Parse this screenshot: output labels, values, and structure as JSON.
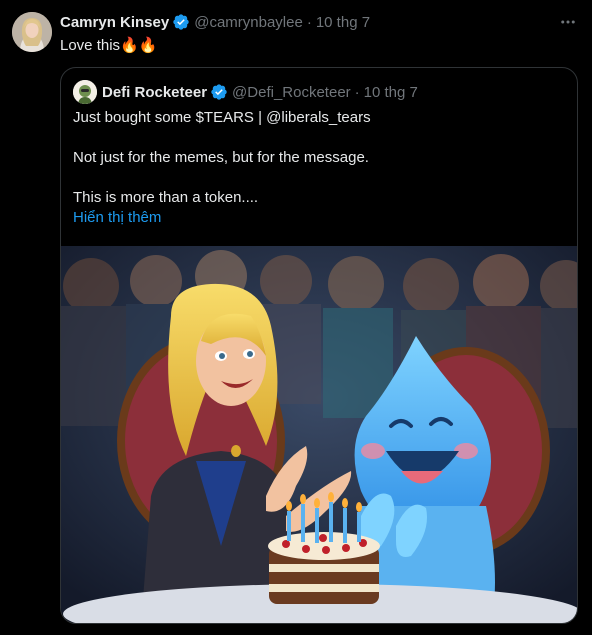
{
  "tweet": {
    "author_name": "Camryn Kinsey",
    "author_handle": "@camrynbaylee",
    "separator": "·",
    "date": "10 thg 7",
    "text": "Love this🔥🔥"
  },
  "quoted_tweet": {
    "author_name": "Defi Rocketeer",
    "author_handle": "@Defi_Rocketeer",
    "separator": "·",
    "date": "10 thg 7",
    "lines": [
      "Just bought some $TEARS | @liberals_tears",
      "Not just for the memes, but for the message.",
      "This is more than a token...."
    ],
    "show_more": "Hiển thị thêm"
  },
  "icons": {
    "verified": "verified-badge-icon",
    "more": "more-options-icon"
  },
  "colors": {
    "background": "#000000",
    "text": "#e7e9ea",
    "muted": "#71767b",
    "accent": "#1d9bf0",
    "border": "#2f3336"
  }
}
